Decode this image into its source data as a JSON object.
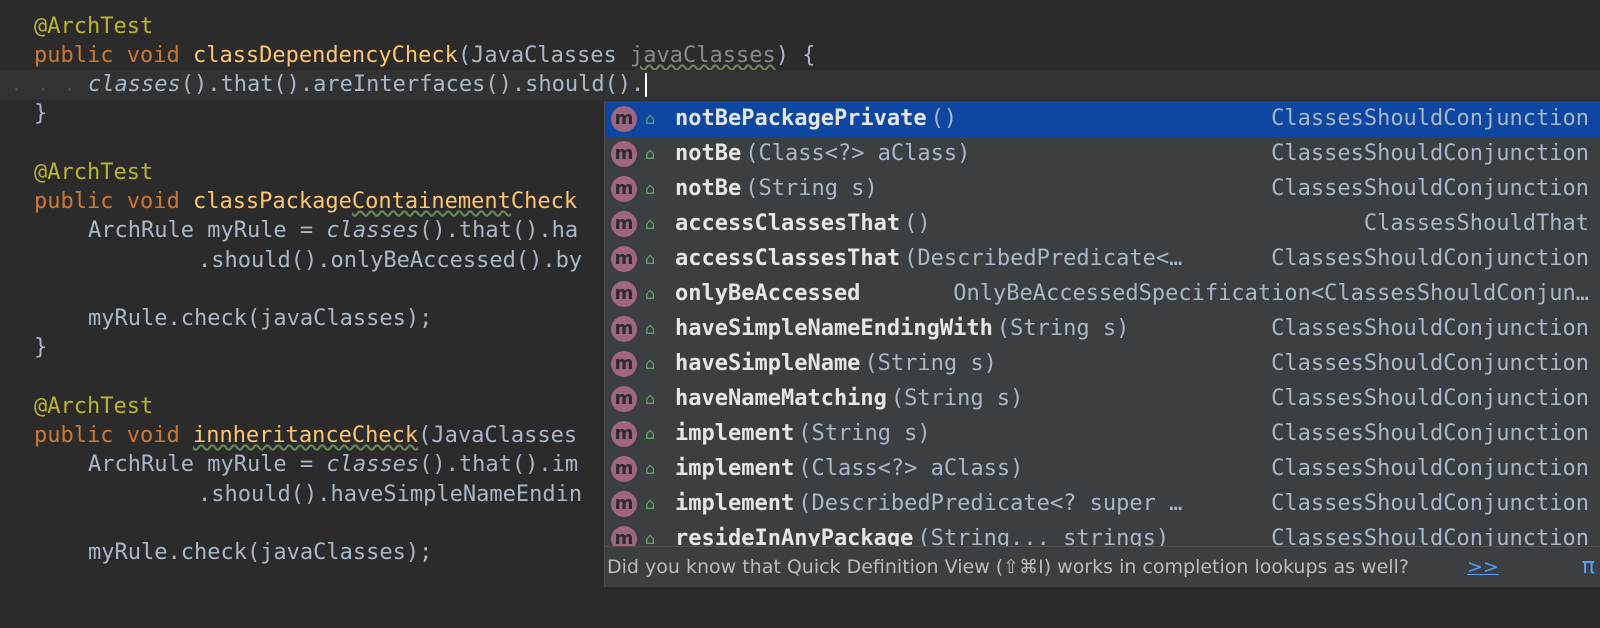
{
  "editor": {
    "lines": [
      {
        "annotation": "@ArchTest"
      },
      {
        "kw": "public void ",
        "method": "classDependencyCheck",
        "paren": "(JavaClasses ",
        "param": "javaClasses",
        "tail": ") {"
      },
      {
        "italic": "classes",
        "rest": "().that().areInterfaces().should()."
      },
      {
        "plain": "}"
      },
      {
        "annotation": "@ArchTest"
      },
      {
        "kw": "public void ",
        "method_a": "classPackage",
        "method_b": "Containement",
        "method_c": "Check"
      },
      {
        "plain_a": "ArchRule myRule = ",
        "italic": "classes",
        "rest": "().that().ha"
      },
      {
        "plain": ".should().onlyBeAccessed().by"
      },
      {
        "plain": "myRule.check(javaClasses);"
      },
      {
        "plain": "}"
      },
      {
        "annotation": "@ArchTest"
      },
      {
        "kw": "public void ",
        "method": "innheritanceCheck",
        "paren": "(JavaClasses"
      },
      {
        "plain_a": "ArchRule myRule = ",
        "italic": "classes",
        "rest": "().that().im"
      },
      {
        "plain": ".should().haveSimpleNameEndin"
      },
      {
        "plain": "myRule.check(javaClasses);"
      }
    ]
  },
  "completion": {
    "method_icon_letter": "m",
    "lock_icon": "lock-open-icon",
    "items": [
      {
        "name": "notBePackagePrivate",
        "sig": "()",
        "type": "ClassesShouldConjunction",
        "selected": true
      },
      {
        "name": "notBe",
        "sig": "(Class<?> aClass)",
        "type": "ClassesShouldConjunction"
      },
      {
        "name": "notBe",
        "sig": "(String s)",
        "type": "ClassesShouldConjunction"
      },
      {
        "name": "accessClassesThat",
        "sig": "()",
        "type": "ClassesShouldThat"
      },
      {
        "name": "accessClassesThat",
        "sig": "(DescribedPredicate<…",
        "type": "ClassesShouldConjunction"
      },
      {
        "name": "onlyBeAccessed",
        "sig": "",
        "type": "OnlyBeAccessedSpecification<ClassesShouldConjun…"
      },
      {
        "name": "haveSimpleNameEndingWith",
        "sig": "(String s)",
        "type": "ClassesShouldConjunction"
      },
      {
        "name": "haveSimpleName",
        "sig": "(String s)",
        "type": "ClassesShouldConjunction"
      },
      {
        "name": "haveNameMatching",
        "sig": "(String s)",
        "type": "ClassesShouldConjunction"
      },
      {
        "name": "implement",
        "sig": "(String s)",
        "type": "ClassesShouldConjunction"
      },
      {
        "name": "implement",
        "sig": "(Class<?> aClass)",
        "type": "ClassesShouldConjunction"
      },
      {
        "name": "implement",
        "sig": "(DescribedPredicate<? super …",
        "type": "ClassesShouldConjunction"
      },
      {
        "name": "resideInAnyPackage",
        "sig": "(String... strings)",
        "type": "ClassesShouldConjunction"
      }
    ],
    "hint": "Did you know that Quick Definition View (⇧⌘I) works in completion lookups as well?",
    "hint_link": ">>",
    "hint_pi": "π"
  },
  "colors": {
    "background": "#2b2b2b",
    "popup": "#3c3f41",
    "selection": "#0d47a1",
    "keyword": "#cc7832",
    "method": "#ffc66d",
    "annotation": "#bbb529"
  }
}
